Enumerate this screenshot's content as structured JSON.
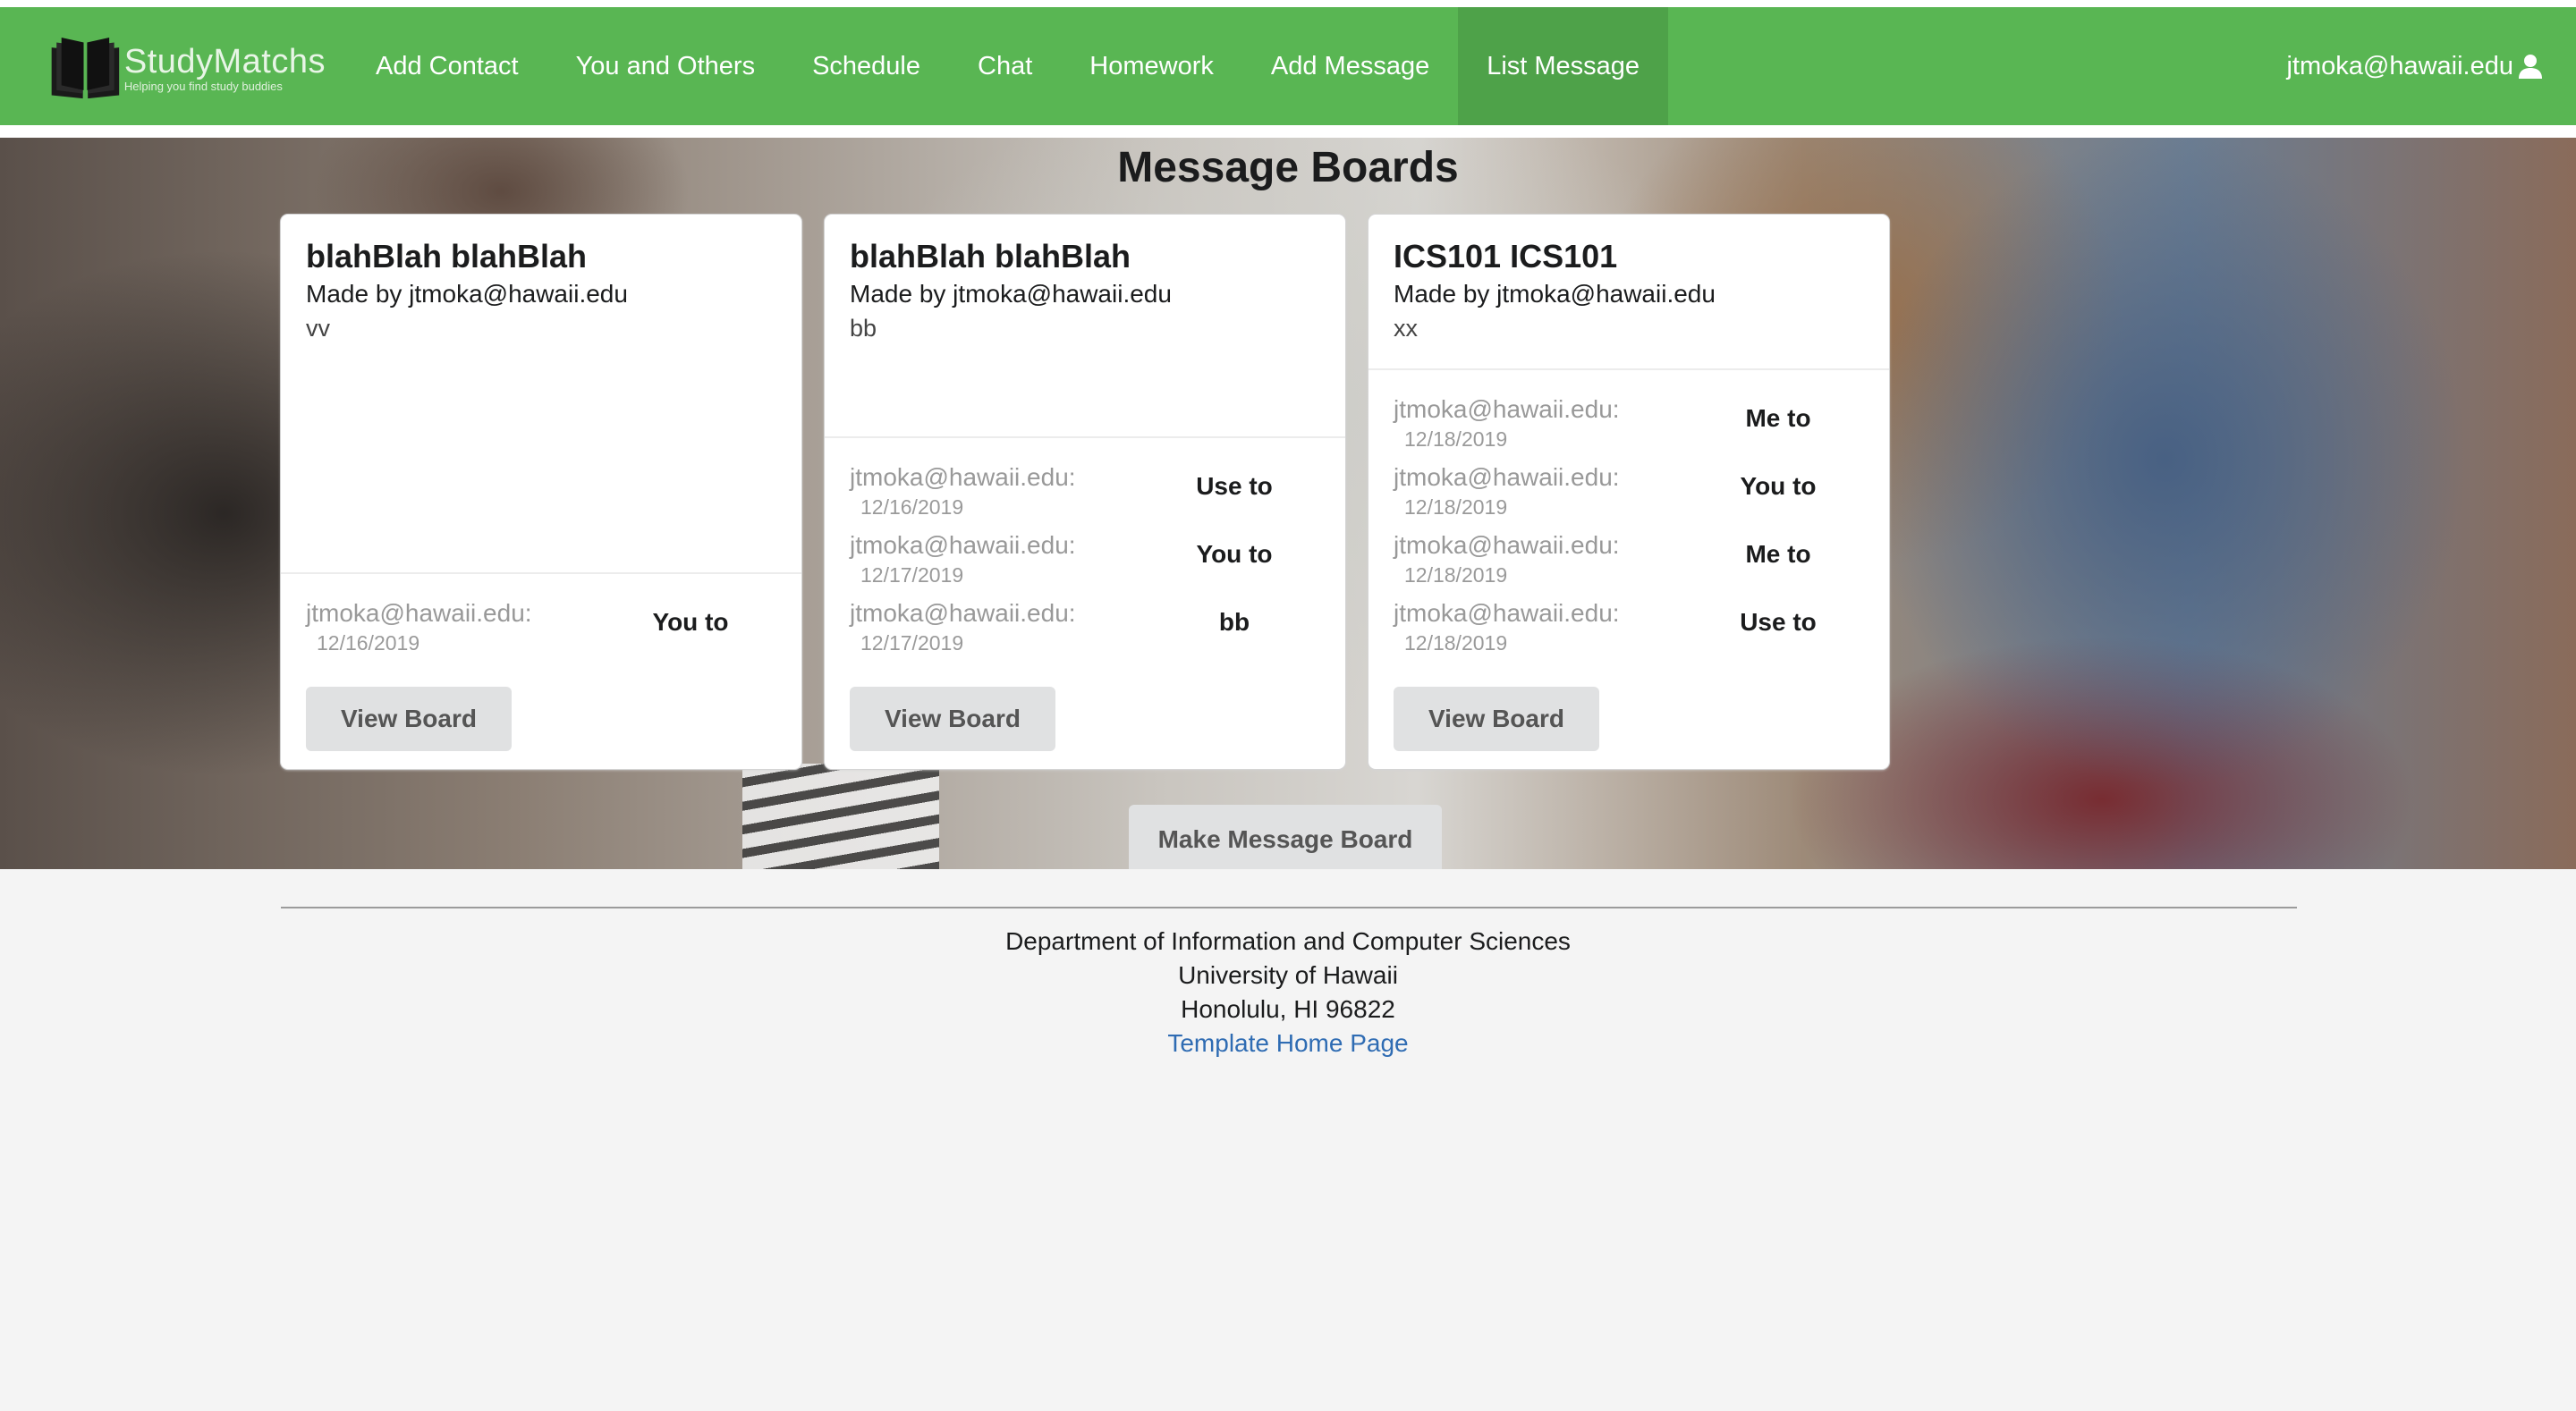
{
  "app": {
    "logo_title": "StudyMatchs",
    "logo_tagline": "Helping you find study buddies"
  },
  "nav": {
    "items": [
      {
        "label": "Add Contact",
        "active": false
      },
      {
        "label": "You and Others",
        "active": false
      },
      {
        "label": "Schedule",
        "active": false
      },
      {
        "label": "Chat",
        "active": false
      },
      {
        "label": "Homework",
        "active": false
      },
      {
        "label": "Add Message",
        "active": false
      },
      {
        "label": "List Message",
        "active": true
      }
    ],
    "user": "jtmoka@hawaii.edu",
    "user_icon": "user-icon"
  },
  "main": {
    "title": "Message Boards",
    "make_button": "Make Message Board"
  },
  "cards": [
    {
      "header": "blahBlah blahBlah",
      "meta": "Made by jtmoka@hawaii.edu",
      "description": "vv",
      "messages": [
        {
          "user": "jtmoka@hawaii.edu:",
          "date": "12/16/2019",
          "text": "You to"
        }
      ],
      "button": "View Board"
    },
    {
      "header": "blahBlah blahBlah",
      "meta": "Made by jtmoka@hawaii.edu",
      "description": "bb",
      "messages": [
        {
          "user": "jtmoka@hawaii.edu:",
          "date": "12/16/2019",
          "text": "Use to"
        },
        {
          "user": "jtmoka@hawaii.edu:",
          "date": "12/17/2019",
          "text": "You to"
        },
        {
          "user": "jtmoka@hawaii.edu:",
          "date": "12/17/2019",
          "text": "bb"
        }
      ],
      "button": "View Board"
    },
    {
      "header": "ICS101 ICS101",
      "meta": "Made by jtmoka@hawaii.edu",
      "description": "xx",
      "messages": [
        {
          "user": "jtmoka@hawaii.edu:",
          "date": "12/18/2019",
          "text": "Me to"
        },
        {
          "user": "jtmoka@hawaii.edu:",
          "date": "12/18/2019",
          "text": "You to"
        },
        {
          "user": "jtmoka@hawaii.edu:",
          "date": "12/18/2019",
          "text": "Me to"
        },
        {
          "user": "jtmoka@hawaii.edu:",
          "date": "12/18/2019",
          "text": "Use to"
        }
      ],
      "button": "View Board"
    }
  ],
  "footer": {
    "line1": "Department of Information and Computer Sciences",
    "line2": "University of Hawaii",
    "line3": "Honolulu, HI 96822",
    "link": "Template Home Page"
  },
  "colors": {
    "navbar": "#59b653",
    "navbar_active": "#4ea249",
    "link": "#2f6cb3",
    "button_bg": "#e0e1e2"
  }
}
